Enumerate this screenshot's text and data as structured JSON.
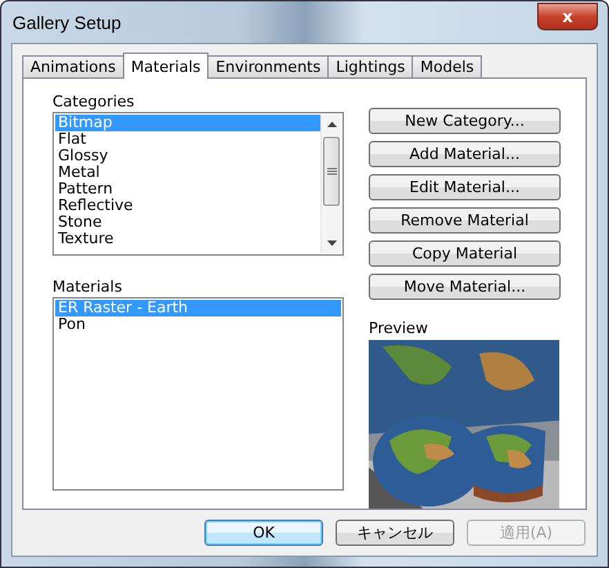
{
  "window": {
    "title": "Gallery Setup",
    "close": "x"
  },
  "tabs": [
    {
      "label": "Animations",
      "selected": false
    },
    {
      "label": "Materials",
      "selected": true
    },
    {
      "label": "Environments",
      "selected": false
    },
    {
      "label": "Lightings",
      "selected": false
    },
    {
      "label": "Models",
      "selected": false
    }
  ],
  "categories": {
    "label": "Categories",
    "items": [
      {
        "label": "Bitmap",
        "selected": true
      },
      {
        "label": "Flat",
        "selected": false
      },
      {
        "label": "Glossy",
        "selected": false
      },
      {
        "label": "Metal",
        "selected": false
      },
      {
        "label": "Pattern",
        "selected": false
      },
      {
        "label": "Reflective",
        "selected": false
      },
      {
        "label": "Stone",
        "selected": false
      },
      {
        "label": "Texture",
        "selected": false
      }
    ]
  },
  "materials": {
    "label": "Materials",
    "items": [
      {
        "label": "ER Raster - Earth",
        "selected": true
      },
      {
        "label": "Pon",
        "selected": false
      }
    ]
  },
  "actions": [
    "New Category...",
    "Add Material...",
    "Edit Material...",
    "Remove Material",
    "Copy Material",
    "Move Material..."
  ],
  "preview": {
    "label": "Preview",
    "kind": "picture"
  },
  "buttons": [
    {
      "label": "OK",
      "kind": "default",
      "disabled": false
    },
    {
      "label": "キャンセル",
      "kind": "normal",
      "disabled": false
    },
    {
      "label": "適用(A)",
      "kind": "normal",
      "disabled": true
    }
  ]
}
